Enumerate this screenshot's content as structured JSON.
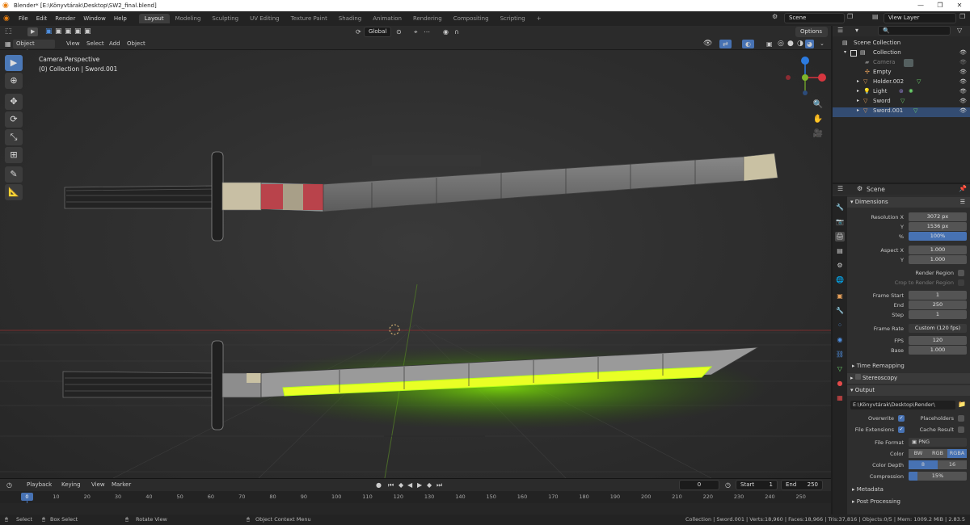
{
  "window": {
    "title": "Blender* [E:\\Könyvtárak\\Desktop\\SW2_final.blend]",
    "controls": [
      "—",
      "❐",
      "✕"
    ]
  },
  "menu": [
    "File",
    "Edit",
    "Render",
    "Window",
    "Help"
  ],
  "workspaces": [
    "Layout",
    "Modeling",
    "Sculpting",
    "UV Editing",
    "Texture Paint",
    "Shading",
    "Animation",
    "Rendering",
    "Compositing",
    "Scripting"
  ],
  "add_workspace": "+",
  "scene_field": "Scene",
  "view_layer_field": "View Layer",
  "viewport": {
    "transform_orientation": "Global",
    "options_label": "Options",
    "mode": "Object Mode",
    "header_menus": [
      "View",
      "Select",
      "Add",
      "Object"
    ],
    "overlay_line1": "Camera Perspective",
    "overlay_line2": "(0) Collection | Sword.001",
    "gizmo_axes": [
      "X",
      "Y",
      "Z"
    ]
  },
  "outliner": {
    "rows": [
      {
        "label": "Scene Collection"
      },
      {
        "label": "Collection"
      },
      {
        "label": "Camera"
      },
      {
        "label": "Empty"
      },
      {
        "label": "Holder.002"
      },
      {
        "label": "Light"
      },
      {
        "label": "Sword"
      },
      {
        "label": "Sword.001"
      }
    ]
  },
  "properties": {
    "context": "Scene",
    "dimensions": {
      "title": "Dimensions",
      "resolution_x_label": "Resolution X",
      "resolution_x": "3072 px",
      "resolution_y_label": "Y",
      "resolution_y": "1536 px",
      "percent_label": "%",
      "percent": "100%",
      "aspect_x_label": "Aspect X",
      "aspect_x": "1.000",
      "aspect_y_label": "Y",
      "aspect_y": "1.000",
      "render_region": "Render Region",
      "crop_region": "Crop to Render Region",
      "frame_start_label": "Frame Start",
      "frame_start": "1",
      "end_label": "End",
      "end": "250",
      "step_label": "Step",
      "step": "1",
      "frame_rate_label": "Frame Rate",
      "frame_rate": "Custom (120 fps)",
      "fps_label": "FPS",
      "fps": "120",
      "base_label": "Base",
      "base": "1.000",
      "time_remapping": "Time Remapping"
    },
    "stereoscopy": "Stereoscopy",
    "output": {
      "title": "Output",
      "path": "E:\\Könyvtárak\\Desktop\\Render\\",
      "overwrite": "Overwrite",
      "placeholders": "Placeholders",
      "file_extensions": "File Extensions",
      "cache_result": "Cache Result",
      "file_format_label": "File Format",
      "file_format": "PNG",
      "color_label": "Color",
      "color_options": [
        "BW",
        "RGB",
        "RGBA"
      ],
      "color_depth_label": "Color Depth",
      "color_depth_options": [
        "8",
        "16"
      ],
      "compression_label": "Compression",
      "compression": "15%",
      "compression_level": 0.15
    },
    "metadata": "Metadata",
    "post_processing": "Post Processing"
  },
  "timeline": {
    "menus": [
      "Playback",
      "Keying",
      "View",
      "Marker"
    ],
    "current_frame": "0",
    "start_label": "Start",
    "start": "1",
    "end_label": "End",
    "end": "250",
    "ticks": [
      "0",
      "10",
      "20",
      "30",
      "40",
      "50",
      "60",
      "70",
      "80",
      "90",
      "100",
      "110",
      "120",
      "130",
      "140",
      "150",
      "160",
      "170",
      "180",
      "190",
      "200",
      "210",
      "220",
      "230",
      "240",
      "250"
    ],
    "playhead": "0"
  },
  "status": {
    "select": "Select",
    "box_select": "Box Select",
    "rotate_view": "Rotate View",
    "context_menu": "Object Context Menu",
    "stats": "Collection | Sword.001 | Verts:18,960 | Faces:18,966 | Tris:37,816 | Objects:0/5 | Mem: 1009.2 MiB | 2.83.5"
  },
  "colors": {
    "accent_blue": "#4772b3",
    "blade_glow": "#b6ff1a",
    "wrap_red": "#c1363f",
    "blender_orange": "#e87d0d"
  }
}
